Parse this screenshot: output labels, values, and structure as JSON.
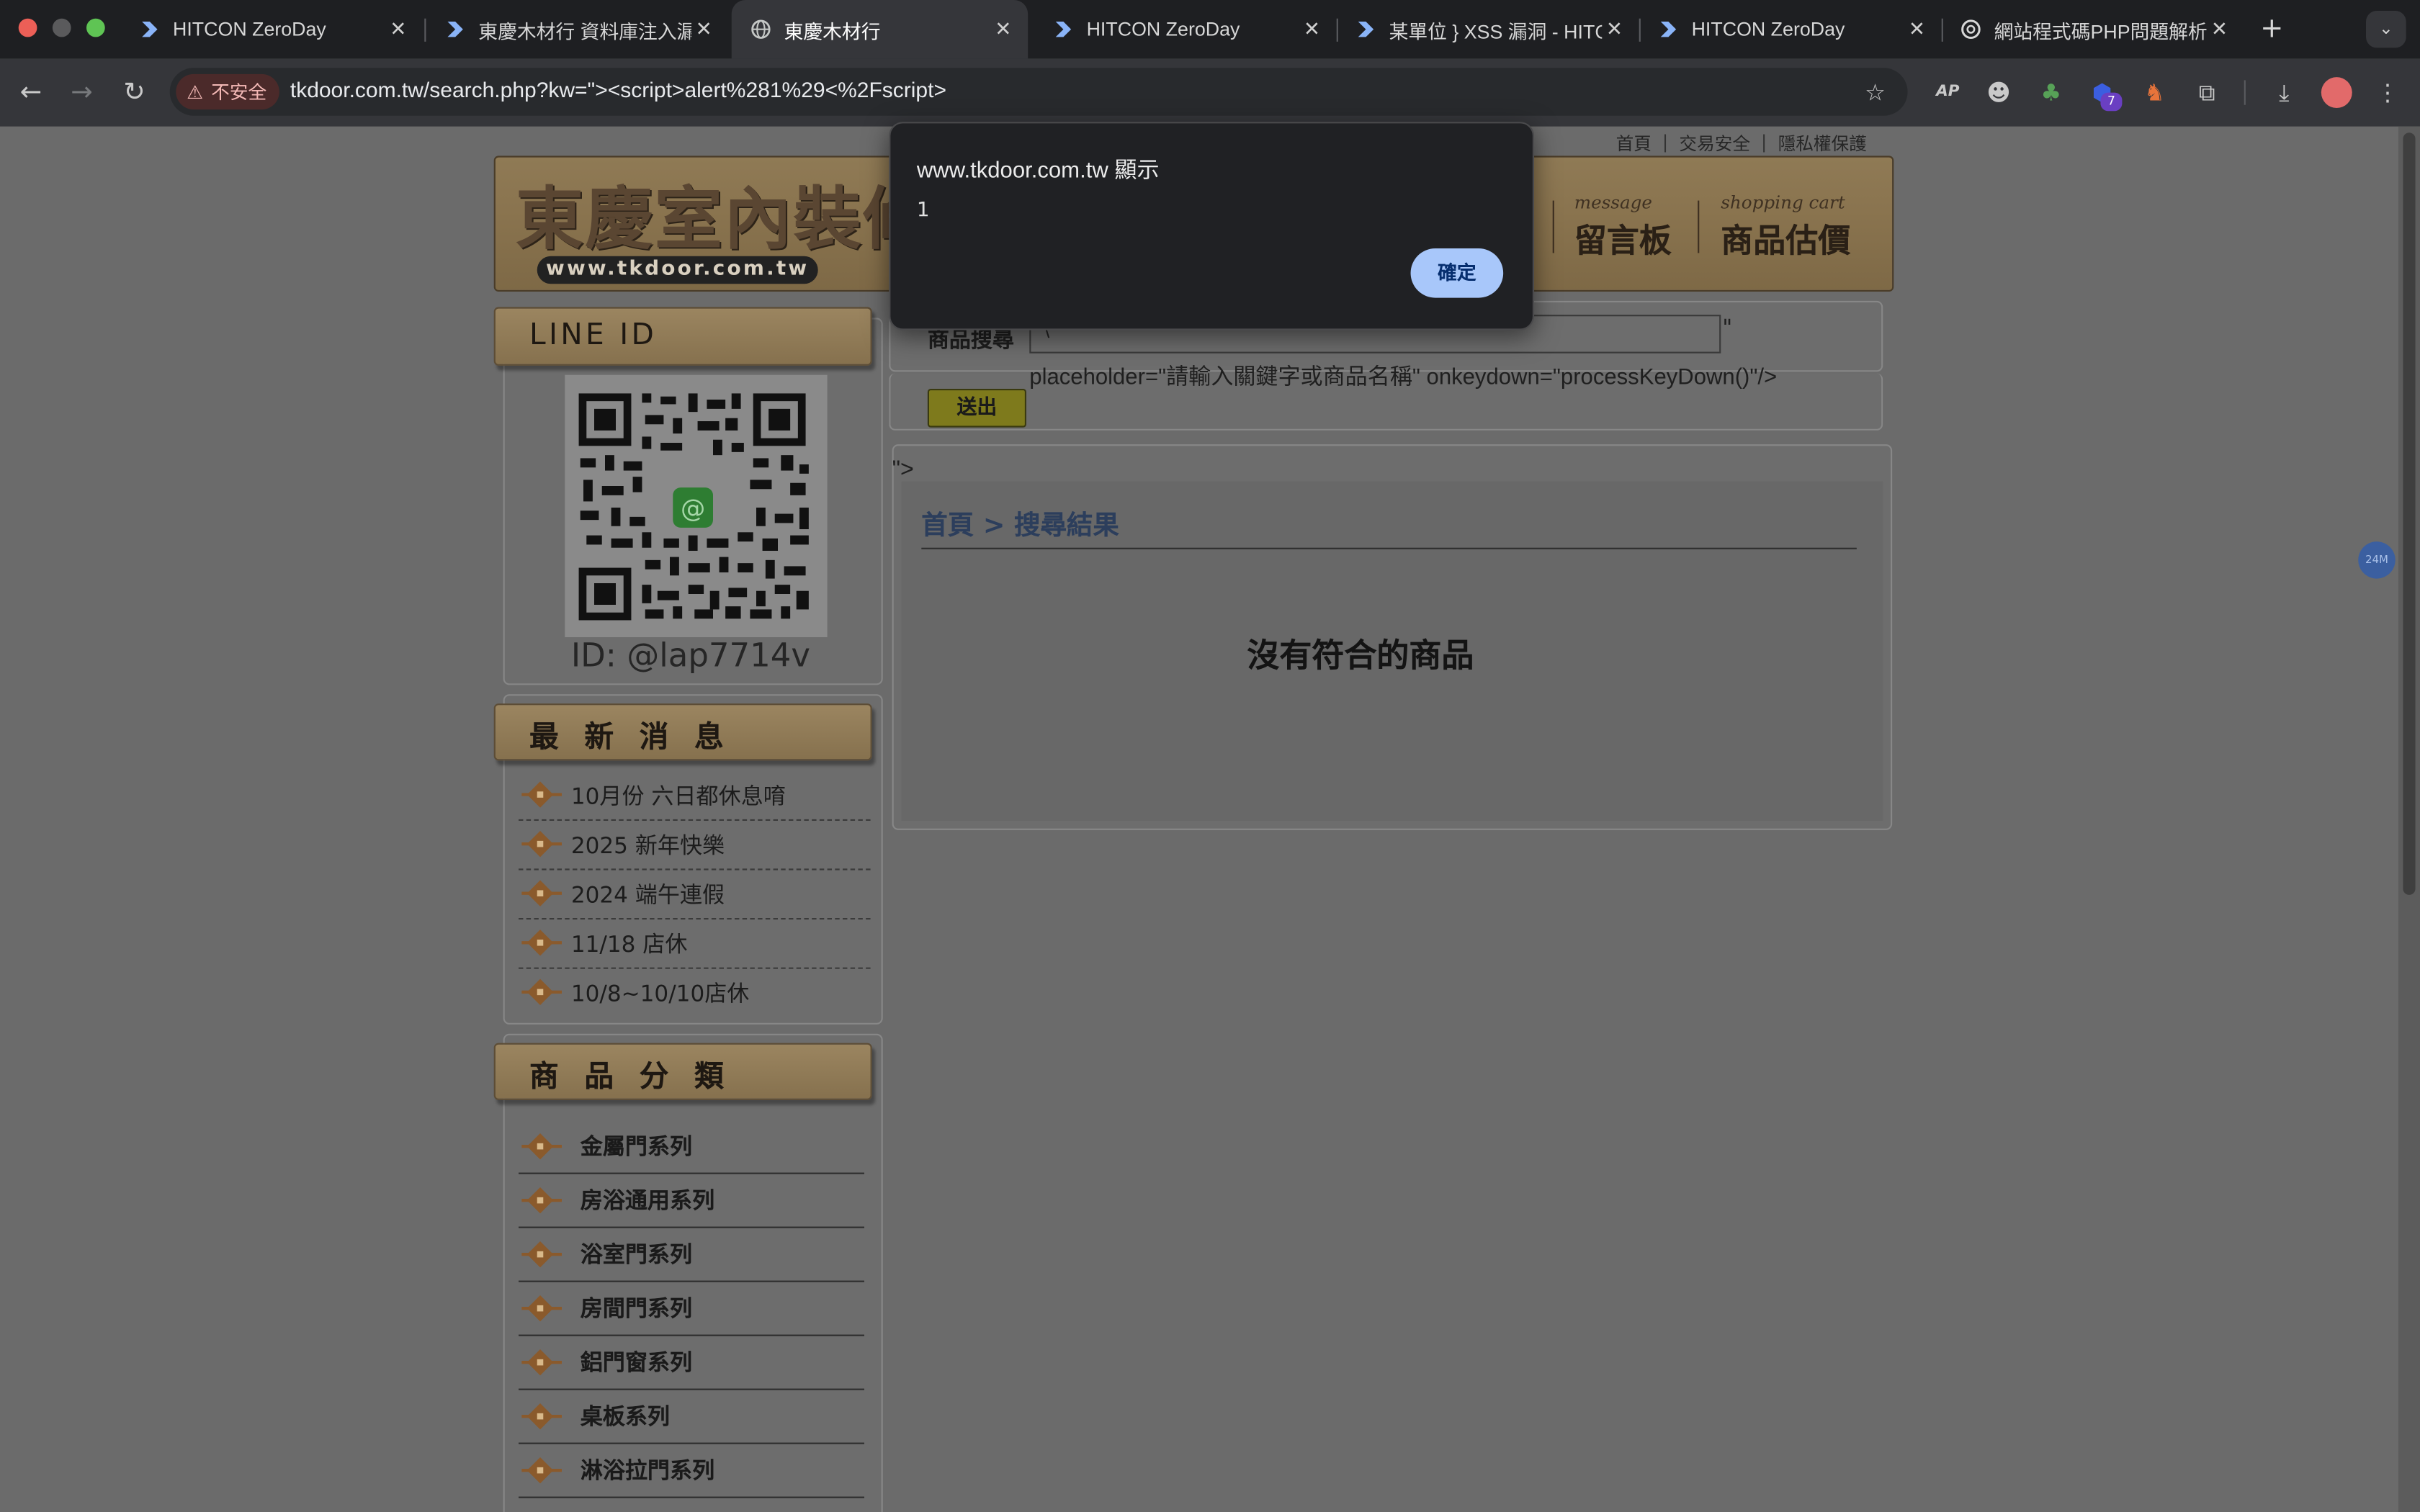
{
  "browser": {
    "tabs": [
      {
        "title": "HITCON ZeroDay",
        "icon": "zeroday-favicon-icon"
      },
      {
        "title": "東慶木材行 資料庫注入漏洞",
        "icon": "zeroday-favicon-icon"
      },
      {
        "title": "東慶木材行",
        "icon": "globe-favicon-icon",
        "active": true
      },
      {
        "title": "HITCON ZeroDay",
        "icon": "zeroday-favicon-icon"
      },
      {
        "title": "某單位 } XSS 漏洞 - HITCON",
        "icon": "zeroday-favicon-icon"
      },
      {
        "title": "HITCON ZeroDay",
        "icon": "zeroday-favicon-icon"
      },
      {
        "title": "網站程式碼PHP問題解析",
        "icon": "openai-favicon-icon"
      }
    ],
    "security_label": "不安全",
    "url": "tkdoor.com.tw/search.php?kw=\"><script>alert%281%29<%2Fscript>",
    "extension_badge": "7"
  },
  "site": {
    "top_links": [
      "首頁",
      "交易安全",
      "隱私權保護"
    ],
    "logo_text": "東慶室內裝修",
    "logo_url": "www.tkdoor.com.tw",
    "banner_nav": [
      {
        "en": "message",
        "zh": "留言板"
      },
      {
        "en": "shopping cart",
        "zh": "商品估價"
      }
    ],
    "line_header": "LINE ID",
    "line_id": "ID: @lap7714v",
    "news_header": "最 新 消 息",
    "news": [
      "10月份 六日都休息唷",
      "2025 新年快樂",
      "2024 端午連假",
      "11/18 店休",
      "10/8~10/10店休"
    ],
    "category_header": "商 品 分 類",
    "categories": [
      "金屬門系列",
      "房浴通用系列",
      "浴室門系列",
      "房間門系列",
      "鋁門窗系列",
      "桌板系列",
      "淋浴拉門系列"
    ],
    "search_label": "商品搜尋",
    "search_value": "\\",
    "injected_fragment_1": "\"",
    "injected_fragment_2": "placeholder=\"請輸入關鍵字或商品名稱\" onkeydown=\"processKeyDown()\"/>",
    "send_button": "送出",
    "injected_fragment_3": "\">",
    "breadcrumb": "首頁 > 搜尋結果",
    "no_results": "沒有符合的商品",
    "floating_badge": "24M"
  },
  "dialog": {
    "title": "www.tkdoor.com.tw 顯示",
    "message": "1",
    "ok_label": "確定"
  },
  "colors": {
    "tabbar": "#1e1f22",
    "toolbar": "#35363a",
    "dialog_bg": "#202124",
    "ok_button": "#a8c7fa",
    "breadcrumb": "#2c3e5c"
  }
}
